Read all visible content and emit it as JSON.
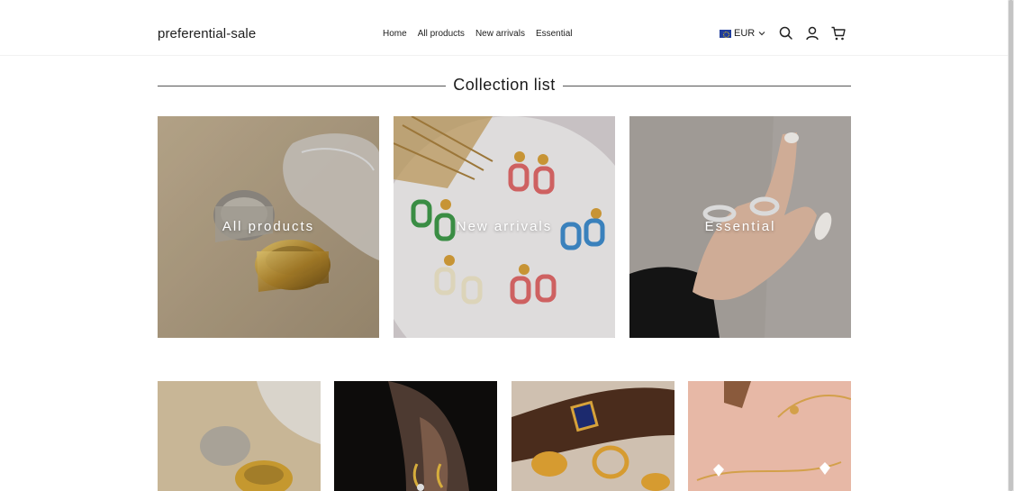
{
  "header": {
    "logo": "preferential-sale",
    "nav": [
      "Home",
      "All products",
      "New arrivals",
      "Essential"
    ],
    "currency": "EUR",
    "icons": [
      "eu-flag-icon",
      "chevron-down-icon",
      "search-icon",
      "account-icon",
      "cart-icon"
    ]
  },
  "collection_list": {
    "title": "Collection list",
    "tiles": [
      {
        "label": "All products"
      },
      {
        "label": "New arrivals"
      },
      {
        "label": "Essential"
      }
    ]
  },
  "colors": {
    "text": "#222222",
    "rule": "#555555",
    "overlay_text": "#ffffff"
  }
}
